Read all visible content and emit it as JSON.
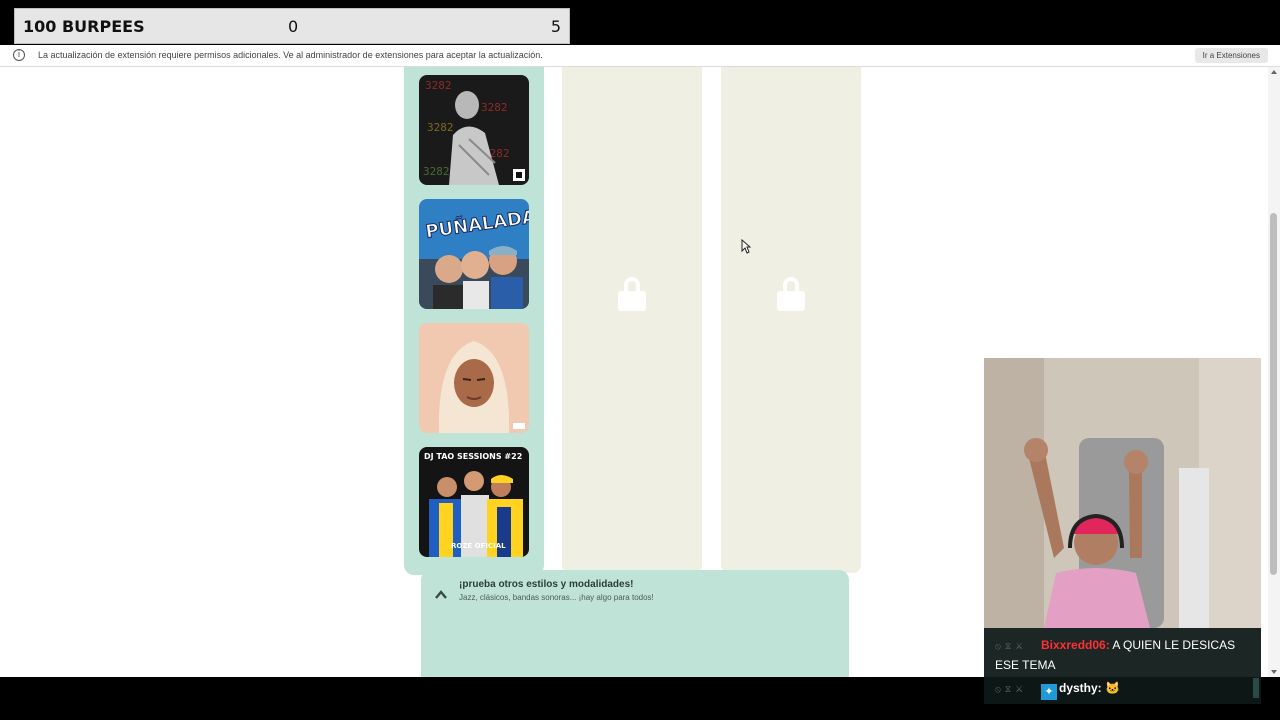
{
  "counter": {
    "title": "100 BURPEES",
    "current": "0",
    "goal": "5"
  },
  "infobar": {
    "message": "La actualización de extensión requiere permisos adicionales. Ve al administrador de extensiones para aceptar la actualización.",
    "button": "Ir a Extensiones"
  },
  "albums": [
    {
      "name": "album-cover-1"
    },
    {
      "name": "album-cover-punaladas",
      "title": "PUÑALADAS"
    },
    {
      "name": "album-cover-3"
    },
    {
      "name": "album-cover-dj-tao",
      "title": "DJ TAO SESSIONS #22",
      "caption": "ROZE OFICIAL"
    }
  ],
  "suggest": {
    "title": "¡prueba otros estilos y modalidades!",
    "subtitle": "Jazz, clásicos, bandas sonoras... ¡hay algo para todos!"
  },
  "chat": {
    "messages": [
      {
        "user": "Bixxredd06:",
        "text": "A QUIEN LE DESICAS ESE TEMA",
        "color": "#ff2f35"
      },
      {
        "user": "dysthy:",
        "text": "",
        "color": "#ffffff"
      }
    ]
  },
  "colors": {
    "mint": "#bfe3d6",
    "locked": "#efefe4",
    "chat_bg": "#0e1816"
  }
}
